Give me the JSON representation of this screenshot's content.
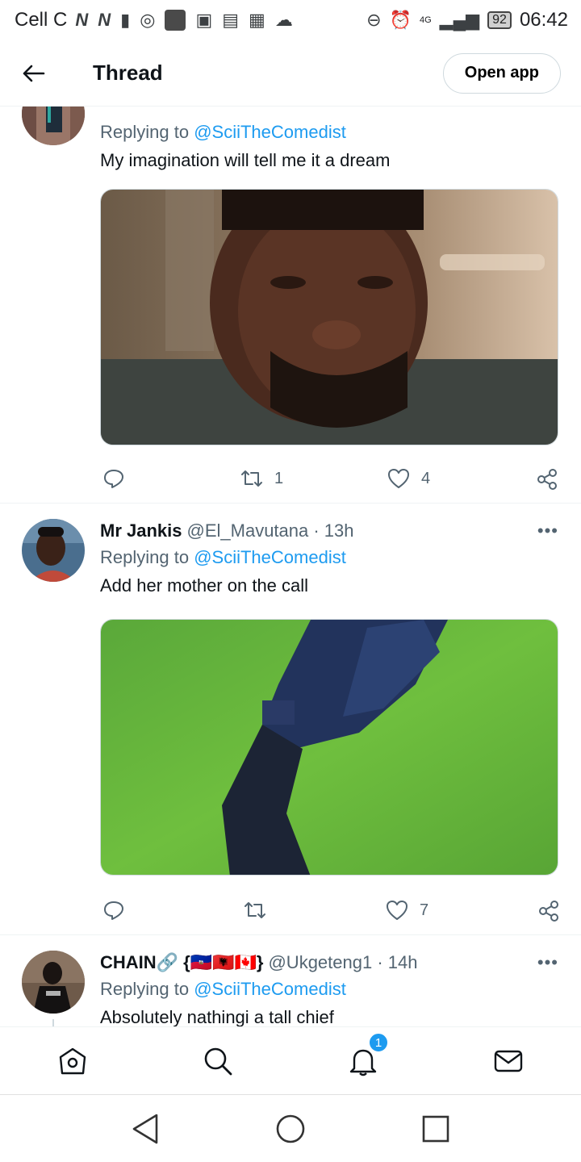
{
  "status_bar": {
    "carrier": "Cell C",
    "network": "4G",
    "battery": "92",
    "time": "06:42"
  },
  "header": {
    "title": "Thread",
    "open_app_label": "Open app"
  },
  "tweets": [
    {
      "reply_prefix": "Replying to",
      "reply_to": "@SciiTheComedist",
      "text": "My imagination will tell me it a dream",
      "retweets": "1",
      "likes": "4"
    },
    {
      "name": "Mr Jankis",
      "meta": "@El_Mavutana · 13h",
      "reply_prefix": "Replying to",
      "reply_to": "@SciiTheComedist",
      "text": "Add her mother on the call",
      "retweets": "",
      "likes": "7"
    },
    {
      "name": "CHAIN🔗 {🇭🇹🇦🇱🇨🇦}",
      "meta": "@Ukgeteng1 · 14h",
      "reply_prefix": "Replying to",
      "reply_to": "@SciiTheComedist",
      "text": "Absolutely nathingi a tall chief"
    }
  ],
  "bottom_nav": {
    "notification_count": "1"
  },
  "colors": {
    "accent": "#1d9bf0",
    "muted": "#536471",
    "text": "#0f1419"
  }
}
